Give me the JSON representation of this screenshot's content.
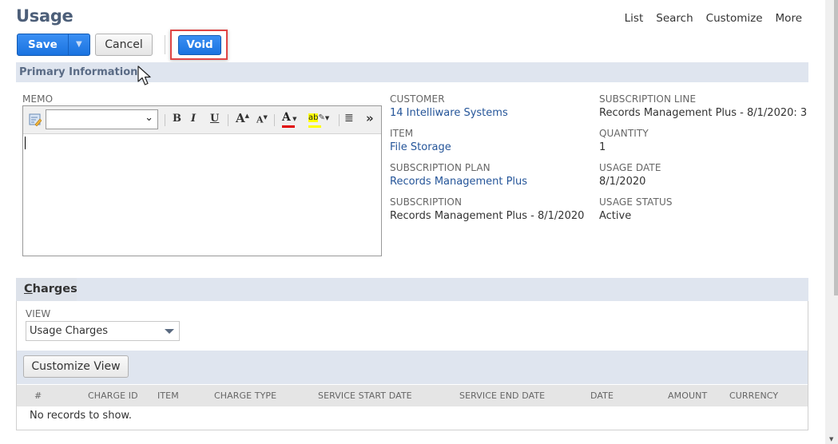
{
  "header": {
    "title": "Usage",
    "links": [
      "List",
      "Search",
      "Customize",
      "More"
    ]
  },
  "toolbar": {
    "save_label": "Save",
    "save_menu_icon": "triangle-down",
    "cancel_label": "Cancel",
    "void_label": "Void",
    "void_highlight_color": "#e04545"
  },
  "primary": {
    "section_title": "Primary Information",
    "memo": {
      "label": "MEMO",
      "value": "",
      "font_select_value": "",
      "toolbar_icons": [
        "edit-source-icon",
        "bold-icon",
        "italic-icon",
        "underline-icon",
        "increase-font-icon",
        "decrease-font-icon",
        "text-color-icon",
        "highlight-color-icon",
        "align-icon",
        "more-icon"
      ],
      "text_color": "#e00000",
      "highlight_color": "#ffff00"
    },
    "fields_col1": [
      {
        "label": "CUSTOMER",
        "value": "14 Intelliware Systems",
        "link": true
      },
      {
        "label": "ITEM",
        "value": "File Storage",
        "link": true
      },
      {
        "label": "SUBSCRIPTION PLAN",
        "value": "Records Management Plus",
        "link": true
      },
      {
        "label": "SUBSCRIPTION",
        "value": "Records Management Plus - 8/1/2020",
        "link": false
      }
    ],
    "fields_col2": [
      {
        "label": "SUBSCRIPTION LINE",
        "value": "Records Management Plus - 8/1/2020: 3"
      },
      {
        "label": "QUANTITY",
        "value": "1"
      },
      {
        "label": "USAGE DATE",
        "value": "8/1/2020"
      },
      {
        "label": "USAGE STATUS",
        "value": "Active"
      }
    ]
  },
  "charges": {
    "tab_first": "C",
    "tab_rest": "harges",
    "view_label": "VIEW",
    "view_value": "Usage Charges",
    "customize_view_label": "Customize View",
    "columns": [
      "#",
      "CHARGE ID",
      "ITEM",
      "CHARGE TYPE",
      "SERVICE START DATE",
      "SERVICE END DATE",
      "DATE",
      "AMOUNT",
      "CURRENCY"
    ],
    "rows": [],
    "empty_message": "No records to show."
  },
  "colors": {
    "primary_button": "#1a73e0",
    "section_bar": "#dfe5ef",
    "title": "#4d5f79",
    "link": "#255599"
  }
}
